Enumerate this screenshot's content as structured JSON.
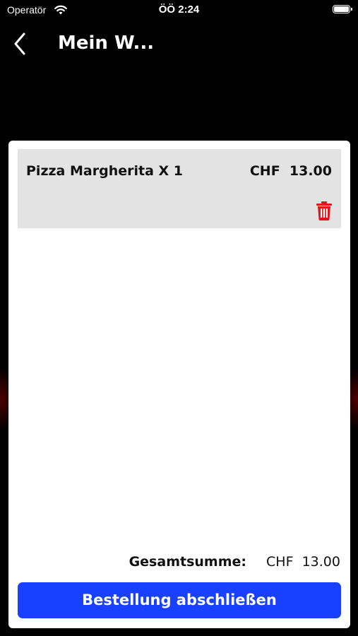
{
  "status_bar": {
    "carrier": "Operatör",
    "time": "ÖÖ 2:24"
  },
  "nav": {
    "title": "Mein W..."
  },
  "cart": {
    "items": [
      {
        "name": "Pizza Margherita X 1",
        "price": "CHF  13.00"
      }
    ],
    "total_label": "Gesamtsumme:",
    "total_value": "CHF  13.00",
    "checkout_label": "Bestellung abschließen"
  },
  "colors": {
    "accent": "#1a40ff",
    "delete": "#e3141c",
    "item_bg": "#e3e3e3"
  }
}
